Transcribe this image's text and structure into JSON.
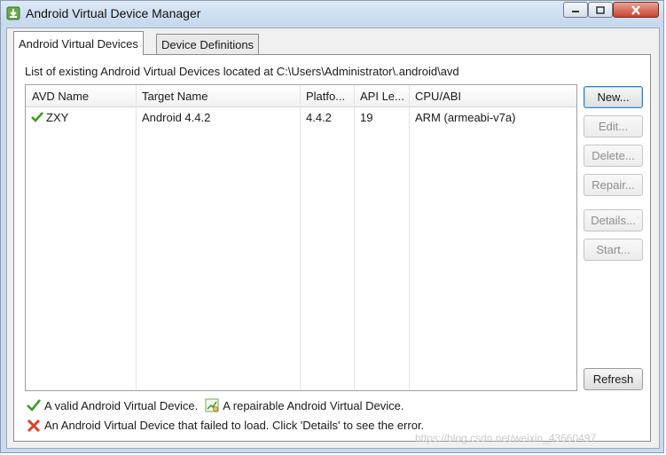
{
  "window": {
    "title": "Android Virtual Device Manager",
    "icon": "android-download-icon",
    "controls": [
      "minimize-icon",
      "maximize-icon",
      "close-icon"
    ]
  },
  "tabs": [
    {
      "label": "Android Virtual Devices",
      "active": true
    },
    {
      "label": "Device Definitions",
      "active": false
    }
  ],
  "path_label": "List of existing Android Virtual Devices located at C:\\Users\\Administrator\\.android\\avd",
  "table": {
    "columns": [
      "AVD Name",
      "Target Name",
      "Platfo...",
      "API Le...",
      "CPU/ABI"
    ],
    "rows": [
      {
        "status_icon": "valid-check-icon",
        "name": "ZXY",
        "target": "Android 4.4.2",
        "platform": "4.4.2",
        "api": "19",
        "cpu": "ARM (armeabi-v7a)"
      }
    ]
  },
  "buttons": {
    "new": "New...",
    "edit": "Edit...",
    "delete": "Delete...",
    "repair": "Repair...",
    "details": "Details...",
    "start": "Start...",
    "refresh": "Refresh"
  },
  "legend": {
    "valid": "A valid Android Virtual Device.",
    "repairable": "A repairable Android Virtual Device.",
    "failed": "An Android Virtual Device that failed to load. Click 'Details' to see the error."
  },
  "watermark": "https://blog.csdn.net/weixin_43660497",
  "colors": {
    "check": "#3f9a2a",
    "error": "#d9432b",
    "window_frame": "#c9dbee"
  }
}
